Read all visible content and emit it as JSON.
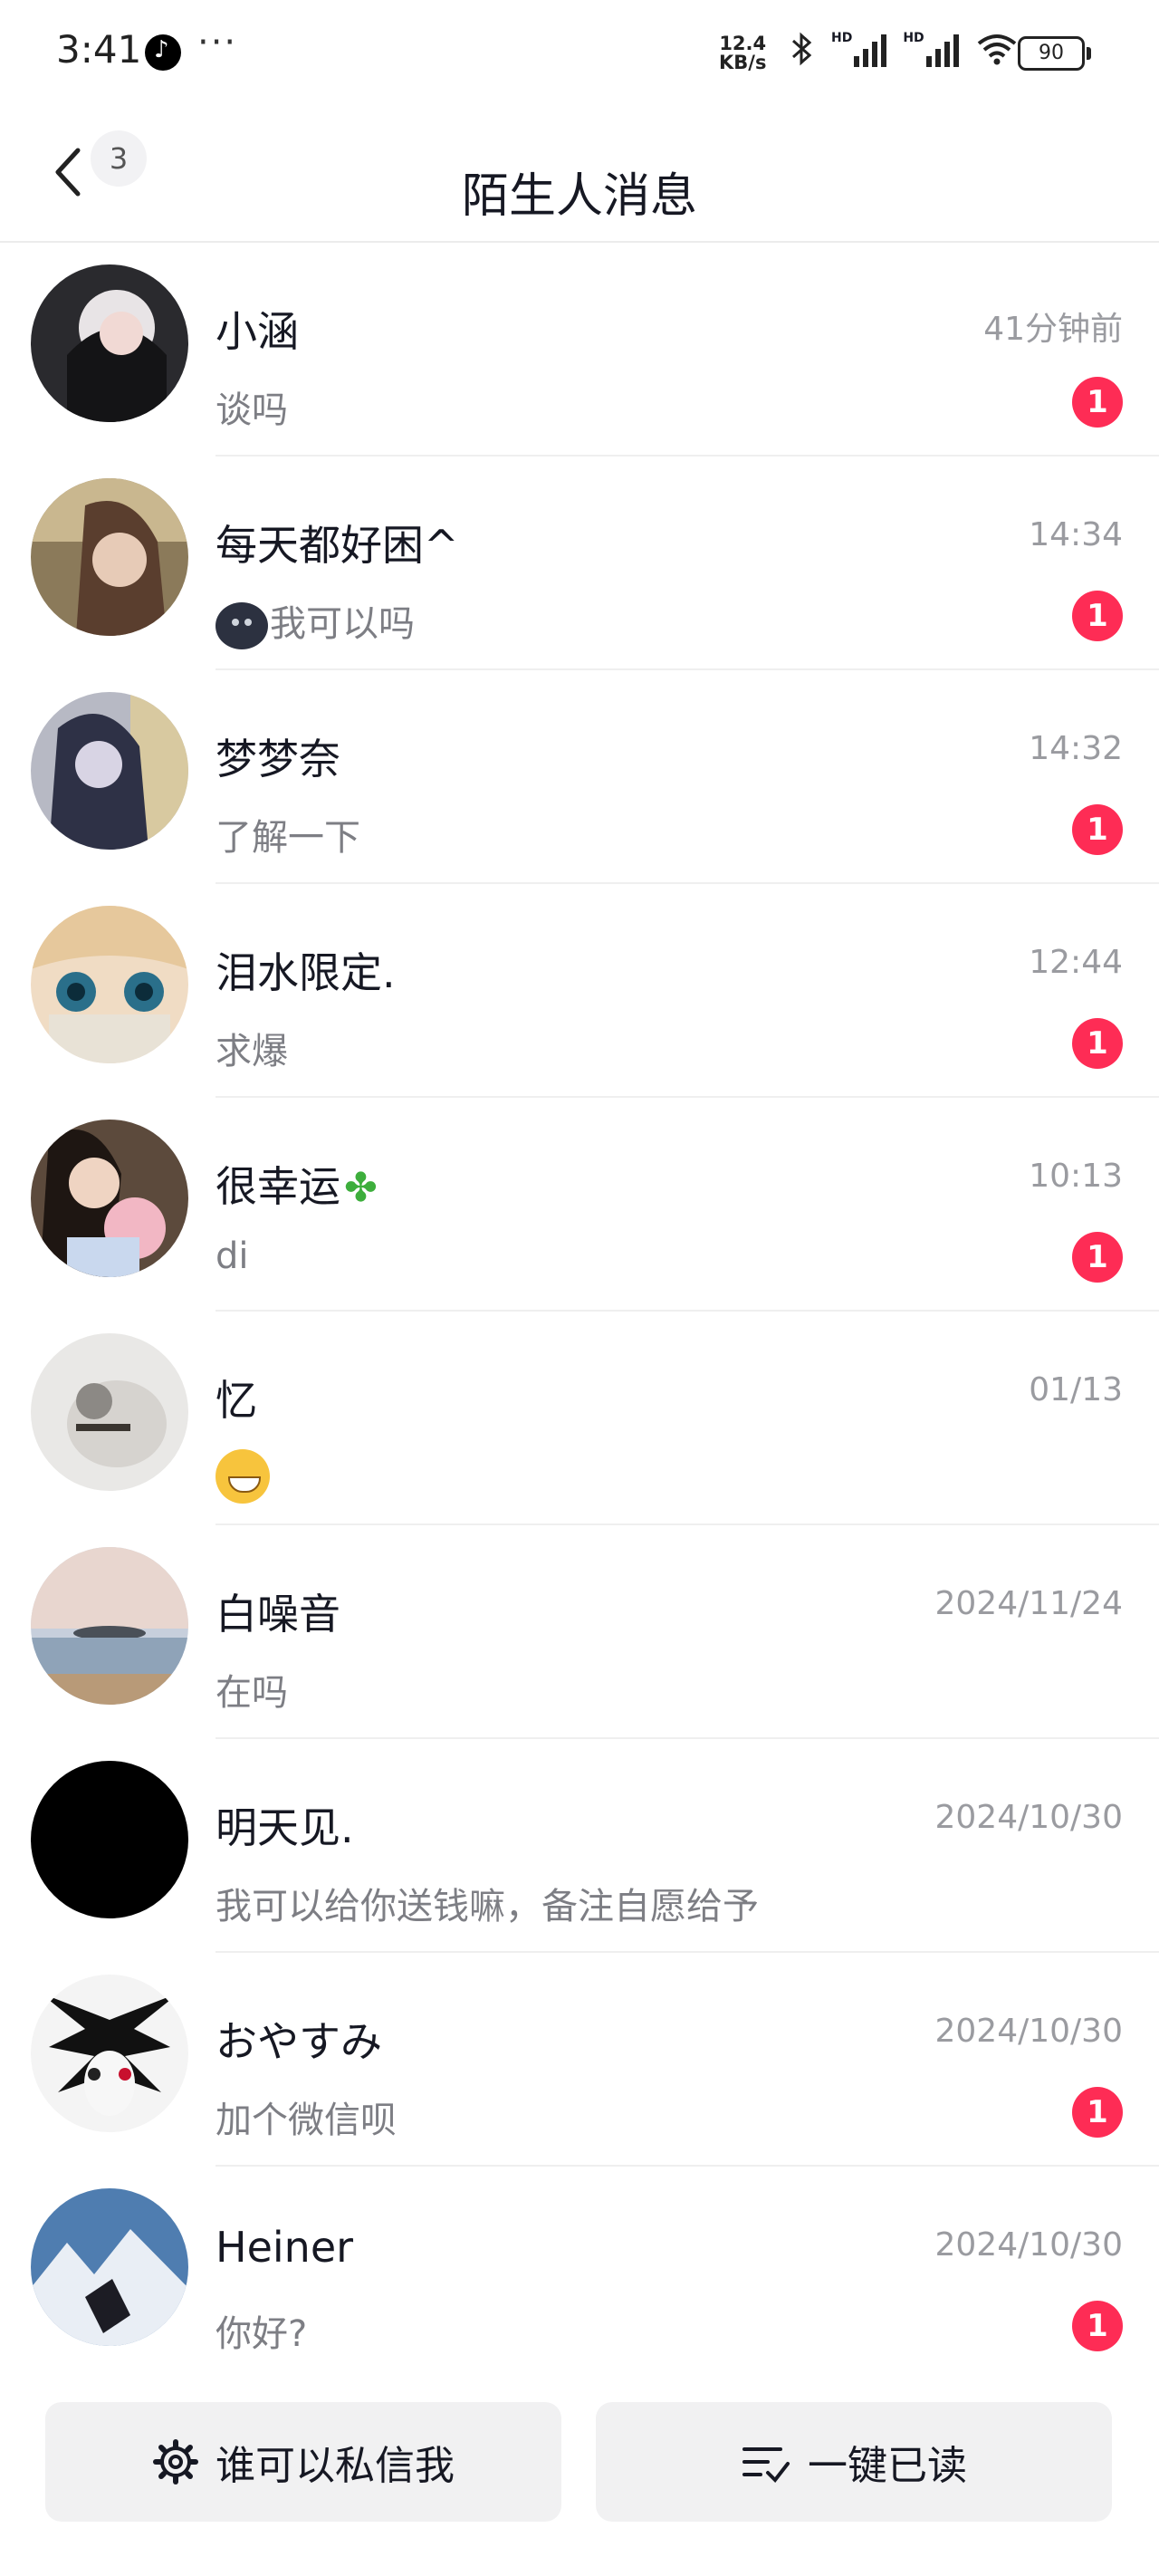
{
  "status_bar": {
    "time": "3:41",
    "more": "···",
    "net_speed_top": "12.4",
    "net_speed_bottom": "KB/s",
    "hd1": "HD",
    "hd2": "HD",
    "battery": "90"
  },
  "header": {
    "back_count": "3",
    "title": "陌生人消息"
  },
  "conversations": [
    {
      "name": "小涵",
      "time": "41分钟前",
      "preview": "谈吗",
      "unread": "1"
    },
    {
      "name": "每天都好困^",
      "time": "14:34",
      "preview": "我可以吗",
      "unread": "1"
    },
    {
      "name": "梦梦奈",
      "time": "14:32",
      "preview": "了解一下",
      "unread": "1"
    },
    {
      "name": "泪水限定.",
      "time": "12:44",
      "preview": "求爆",
      "unread": "1"
    },
    {
      "name": "很幸运",
      "time": "10:13",
      "preview": "di",
      "unread": "1"
    },
    {
      "name": "忆",
      "time": "01/13",
      "preview": "",
      "unread": ""
    },
    {
      "name": "白噪音",
      "time": "2024/11/24",
      "preview": "在吗",
      "unread": ""
    },
    {
      "name": "明天见.",
      "time": "2024/10/30",
      "preview": "我可以给你送钱嘛，备注自愿给予",
      "unread": ""
    },
    {
      "name": "おやすみ",
      "time": "2024/10/30",
      "preview": "加个微信呗",
      "unread": "1"
    },
    {
      "name": "Heiner",
      "time": "2024/10/30",
      "preview": "你好?",
      "unread": "1"
    }
  ],
  "footer": {
    "privacy_button": "谁可以私信我",
    "mark_read_button": "一键已读"
  },
  "colors": {
    "badge": "#fe2c55",
    "button_bg": "#f1f1f2",
    "secondary_text": "#9a9ba0"
  },
  "icons": [
    "back-arrow-icon",
    "gear-icon",
    "mark-read-icon",
    "bluetooth-icon",
    "wifi-icon",
    "signal-icon",
    "battery-icon",
    "clover-icon"
  ]
}
